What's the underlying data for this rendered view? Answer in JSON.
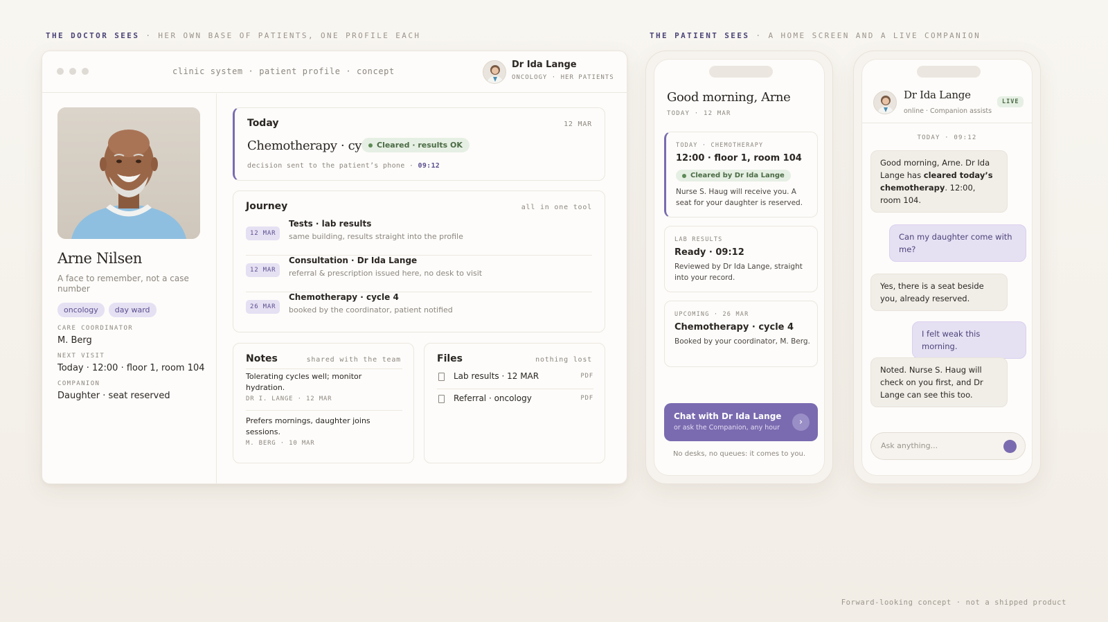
{
  "labels": {
    "doctor_bold": "THE DOCTOR SEES",
    "doctor_rest": " · HER OWN BASE OF PATIENTS, ONE PROFILE EACH",
    "patient_bold": "THE PATIENT SEES",
    "patient_rest": " · A HOME SCREEN AND A LIVE COMPANION"
  },
  "window": {
    "title": "clinic system · patient profile · concept",
    "doctor_name": "Dr Ida Lange",
    "doctor_sub": "ONCOLOGY · HER PATIENTS"
  },
  "patient": {
    "name": "Arne Nilsen",
    "tagline": "A face to remember, not a case number",
    "chips": [
      "oncology",
      "day ward"
    ],
    "care_coordinator_label": "CARE COORDINATOR",
    "care_coordinator": "M. Berg",
    "next_visit_label": "NEXT VISIT",
    "next_visit": "Today · 12:00 · floor 1, room 104",
    "companion_label": "COMPANION",
    "companion": "Daughter · seat reserved"
  },
  "today": {
    "title": "Today",
    "date": "12 MAR",
    "treatment": "Chemotherapy · cycle 3",
    "badge": "Cleared · results OK",
    "decision": "decision sent to the patient’s phone · ",
    "decision_time": "09:12"
  },
  "journey": {
    "title": "Journey",
    "right": "all in one tool",
    "items": [
      {
        "date": "12 MAR",
        "title": "Tests · lab results",
        "sub": "same building, results straight into the profile"
      },
      {
        "date": "12 MAR",
        "title": "Consultation · Dr Ida Lange",
        "sub": "referral & prescription issued here, no desk to visit"
      },
      {
        "date": "26 MAR",
        "title": "Chemotherapy · cycle 4",
        "sub": "booked by the coordinator, patient notified"
      }
    ]
  },
  "notes": {
    "title": "Notes",
    "right": "shared with the team",
    "items": [
      {
        "text": "Tolerating cycles well; monitor hydration.",
        "by": "DR I. LANGE · 12 MAR"
      },
      {
        "text": "Prefers mornings, daughter joins sessions.",
        "by": "M. BERG · 10 MAR"
      }
    ]
  },
  "files": {
    "title": "Files",
    "right": "nothing lost",
    "items": [
      {
        "name": "Lab results · 12 MAR",
        "type": "PDF"
      },
      {
        "name": "Referral · oncology",
        "type": "PDF"
      }
    ]
  },
  "home": {
    "greeting": "Good morning, Arne",
    "date": "TODAY · 12 MAR",
    "card1_label": "TODAY · CHEMOTHERAPY",
    "card1_title": "12:00 · floor 1, room 104",
    "card1_badge": "Cleared by Dr Ida Lange",
    "card1_text": "Nurse S. Haug will receive you. A seat for your daughter is reserved.",
    "card2_label": "LAB RESULTS",
    "card2_title": "Ready · 09:12",
    "card2_text": "Reviewed by Dr Ida Lange, straight into your record.",
    "card3_label": "UPCOMING · 26 MAR",
    "card3_title": "Chemotherapy · cycle 4",
    "card3_text": "Booked by your coordinator, M. Berg.",
    "cta_title": "Chat with Dr Ida Lange",
    "cta_sub": "or ask the Companion, any hour",
    "foot": "No desks, no queues: it comes to you."
  },
  "chat": {
    "name": "Dr Ida Lange",
    "status": "online · Companion assists",
    "live": "LIVE",
    "date": "TODAY · 09:12",
    "m1_a": "Good morning, Arne. Dr Ida Lange has ",
    "m1_b": "cleared today’s chemotherapy",
    "m1_c": ". 12:00, room 104.",
    "m2": "Can my daughter come with me?",
    "m3": "Yes, there is a seat beside you, already reserved.",
    "m4": "I felt weak this morning.",
    "m5": "Noted. Nurse S. Haug will check on you first, and Dr Lange can see this too.",
    "placeholder": "Ask anything..."
  },
  "footer": "Forward-looking concept · not a shipped product",
  "colors": {
    "accent": "#7a6bb0",
    "success": "#5d8a56",
    "chip_bg": "#e6e0f3"
  },
  "icons": {
    "file": "file-icon",
    "arrow": "chevron-right-icon",
    "send": "send-icon"
  }
}
